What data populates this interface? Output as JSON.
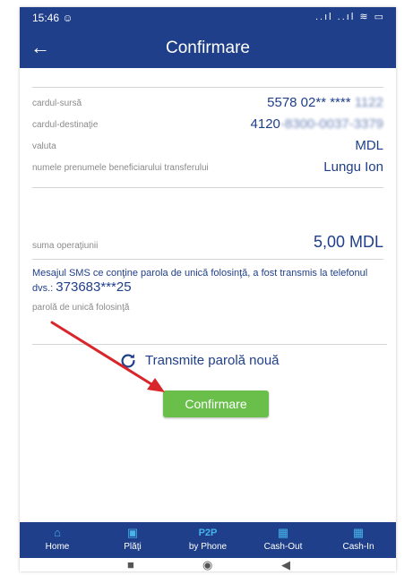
{
  "status_bar": {
    "time": "15:46 ☺",
    "icons": "..ıl ..ıl ≋ ▭"
  },
  "header": {
    "back_icon": "←",
    "title": "Confirmare"
  },
  "details": {
    "source_card_label": "cardul-sursă",
    "source_card_value": "5578 02** ****",
    "source_card_masked": "1122",
    "dest_card_label": "cardul-destinaţie",
    "dest_card_value": "4120",
    "dest_card_masked": "-8300-0037-3379",
    "currency_label": "valuta",
    "currency_value": "MDL",
    "beneficiary_label": "numele prenumele beneficiarului transferului",
    "beneficiary_value": "Lungu Ion"
  },
  "amount": {
    "label": "suma operaţiunii",
    "value": "5,00 MDL"
  },
  "sms": {
    "text": "Mesajul SMS ce conţine parola de unică folosinţă, a fost transmis la telefonul dvs.:",
    "phone": "373683***25"
  },
  "otp": {
    "label": "parolă de unică folosinţă",
    "value": ""
  },
  "resend": {
    "label": "Transmite parolă nouă"
  },
  "confirm": {
    "label": "Confirmare"
  },
  "bottom_nav": [
    {
      "label": "Home",
      "icon": "home-icon",
      "glyph": "⌂"
    },
    {
      "label": "Plăţi",
      "icon": "wallet-icon",
      "glyph": "▣"
    },
    {
      "label": "by Phone",
      "icon": "p2p-text",
      "glyph": "P2P"
    },
    {
      "label": "Cash-Out",
      "icon": "atm-icon",
      "glyph": "▦"
    },
    {
      "label": "Cash-In",
      "icon": "atm-deposit-icon",
      "glyph": "▦"
    }
  ],
  "system_nav": {
    "recent": "■",
    "home": "◉",
    "back": "◀"
  },
  "colors": {
    "primary": "#1f3f8a",
    "accent": "#44b4ea",
    "confirm_green": "#6abf4b",
    "annotation_arrow": "#d8262b"
  }
}
